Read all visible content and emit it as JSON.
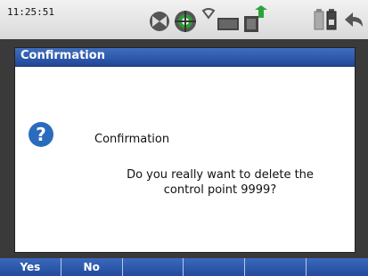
{
  "status_bar": {
    "time": "11:25:51",
    "icons": [
      "gps-satellite-icon",
      "target-icon",
      "wifi-icon",
      "network-card-icon",
      "usb-transfer-icon",
      "battery-icon",
      "battery-icon",
      "back-icon"
    ]
  },
  "dialog": {
    "title": "Confirmation",
    "heading": "Confirmation",
    "message_line1": "Do you really want to delete the",
    "message_line2": "control point 9999?",
    "icon": "question-icon"
  },
  "softkeys": [
    "Yes",
    "No",
    "",
    "",
    "",
    ""
  ],
  "colors": {
    "accent": "#2a55a8",
    "question_icon": "#2b6bbd"
  }
}
